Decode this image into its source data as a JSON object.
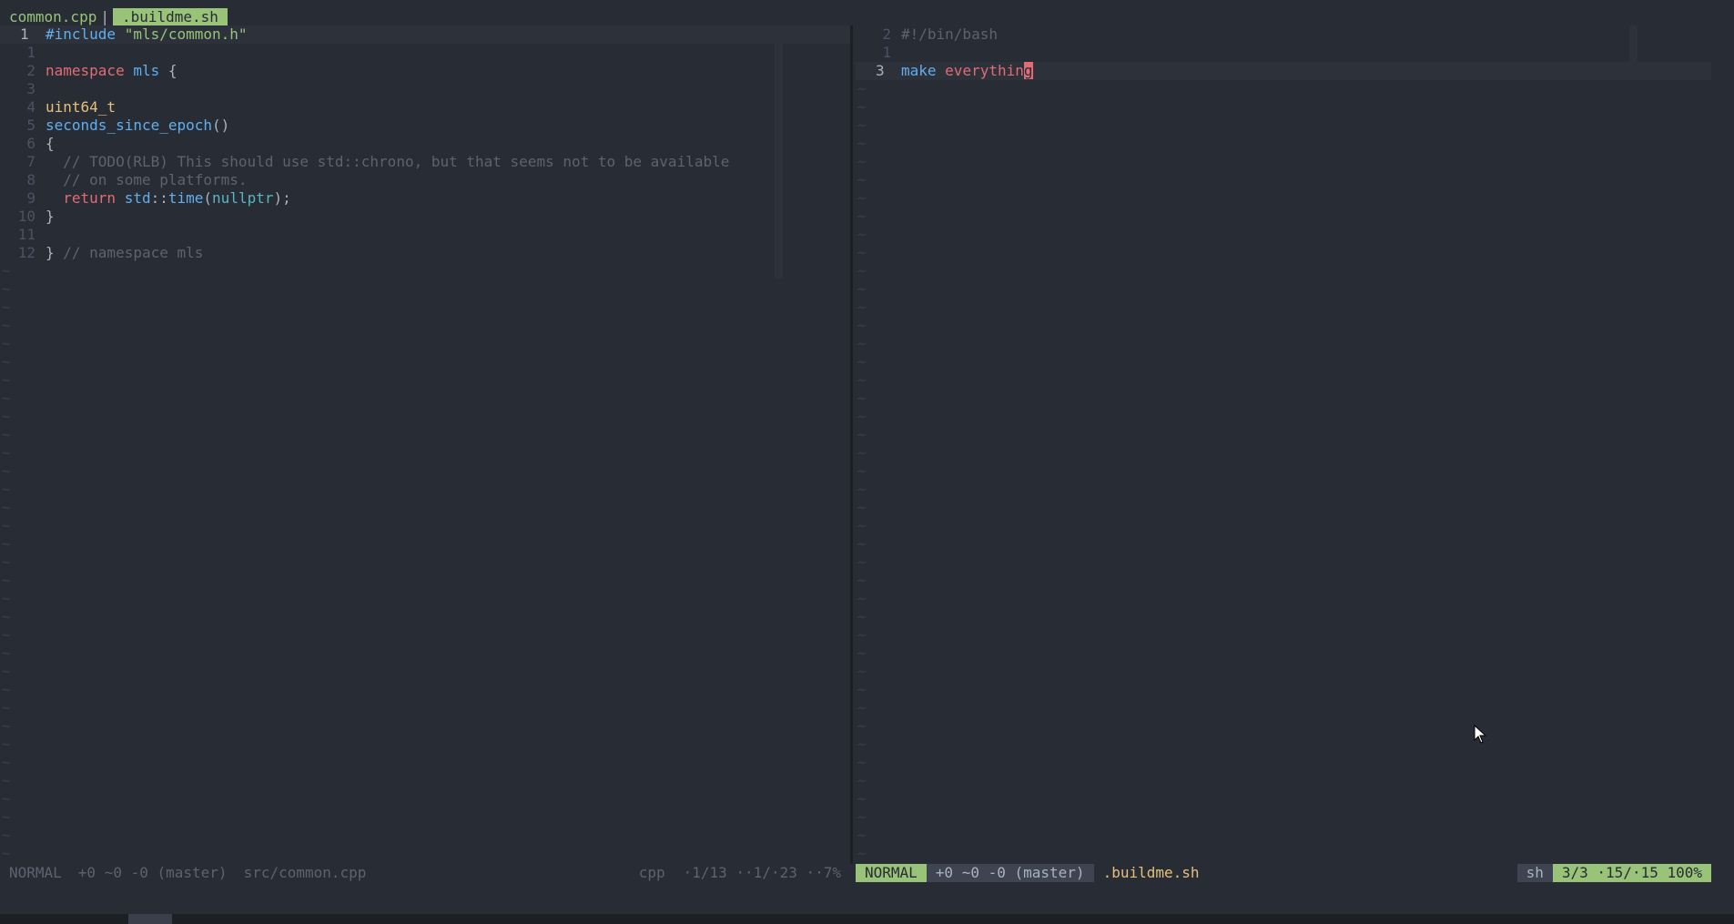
{
  "tabline": {
    "inactive_tab": "common.cpp",
    "separator": "|",
    "active_tab": ".buildme.sh"
  },
  "left_pane": {
    "lines": [
      {
        "num": "1",
        "segments": [
          {
            "cls": "c-include",
            "text": "#include "
          },
          {
            "cls": "c-string",
            "text": "\"mls/common.h\""
          }
        ]
      },
      {
        "num": "1",
        "segments": []
      },
      {
        "num": "2",
        "segments": [
          {
            "cls": "c-keyword",
            "text": "namespace"
          },
          {
            "cls": "c-plain",
            "text": " "
          },
          {
            "cls": "c-ns",
            "text": "mls"
          },
          {
            "cls": "c-plain",
            "text": " {"
          }
        ]
      },
      {
        "num": "3",
        "segments": []
      },
      {
        "num": "4",
        "segments": [
          {
            "cls": "c-type",
            "text": "uint64_t"
          }
        ]
      },
      {
        "num": "5",
        "segments": [
          {
            "cls": "c-func",
            "text": "seconds_since_epoch"
          },
          {
            "cls": "c-plain",
            "text": "()"
          }
        ]
      },
      {
        "num": "6",
        "segments": [
          {
            "cls": "c-plain",
            "text": "{"
          }
        ]
      },
      {
        "num": "7",
        "segments": [
          {
            "cls": "c-comment",
            "text": "  // TODO(RLB) This should use std::chrono, but that seems not to be available"
          }
        ]
      },
      {
        "num": "8",
        "segments": [
          {
            "cls": "c-comment",
            "text": "  // on some platforms."
          }
        ]
      },
      {
        "num": "9",
        "segments": [
          {
            "cls": "c-plain",
            "text": "  "
          },
          {
            "cls": "c-keyword",
            "text": "return"
          },
          {
            "cls": "c-plain",
            "text": " "
          },
          {
            "cls": "c-ns",
            "text": "std"
          },
          {
            "cls": "c-plain",
            "text": "::"
          },
          {
            "cls": "c-func",
            "text": "time"
          },
          {
            "cls": "c-plain",
            "text": "("
          },
          {
            "cls": "c-nullptr",
            "text": "nullptr"
          },
          {
            "cls": "c-plain",
            "text": ");"
          }
        ]
      },
      {
        "num": "10",
        "segments": [
          {
            "cls": "c-plain",
            "text": "}"
          }
        ]
      },
      {
        "num": "11",
        "segments": []
      },
      {
        "num": "12",
        "segments": [
          {
            "cls": "c-plain",
            "text": "} "
          },
          {
            "cls": "c-comment",
            "text": "// namespace mls"
          }
        ]
      }
    ],
    "tilde": "~"
  },
  "right_pane": {
    "lines": [
      {
        "num": "2",
        "segments": [
          {
            "cls": "c-shebang",
            "text": "#!/bin/bash"
          }
        ]
      },
      {
        "num": "1",
        "segments": []
      },
      {
        "num": "3",
        "segments": [
          {
            "cls": "c-cmd",
            "text": "make"
          },
          {
            "cls": "c-plain",
            "text": " "
          },
          {
            "cls": "c-arg",
            "text": "everythin"
          },
          {
            "cls": "cursor-char",
            "text": "g"
          }
        ]
      }
    ],
    "tilde": "~"
  },
  "statusbar_left": {
    "mode": "NORMAL",
    "git": "+0 ~0 -0 (master)",
    "file": "src/common.cpp",
    "filetype": "cpp",
    "position": "·1/13 ··1/·23 ··7%"
  },
  "statusbar_right": {
    "mode": "NORMAL",
    "git": "+0 ~0 -0 (master)",
    "file": ".buildme.sh",
    "filetype": "sh",
    "position": "3/3 ·15/·15 100%"
  },
  "colors": {
    "background": "#282c34",
    "accent_green": "#98c379",
    "keyword_red": "#e06c75",
    "function_blue": "#61afef",
    "type_yellow": "#e5c07b",
    "comment_gray": "#5c6370"
  }
}
